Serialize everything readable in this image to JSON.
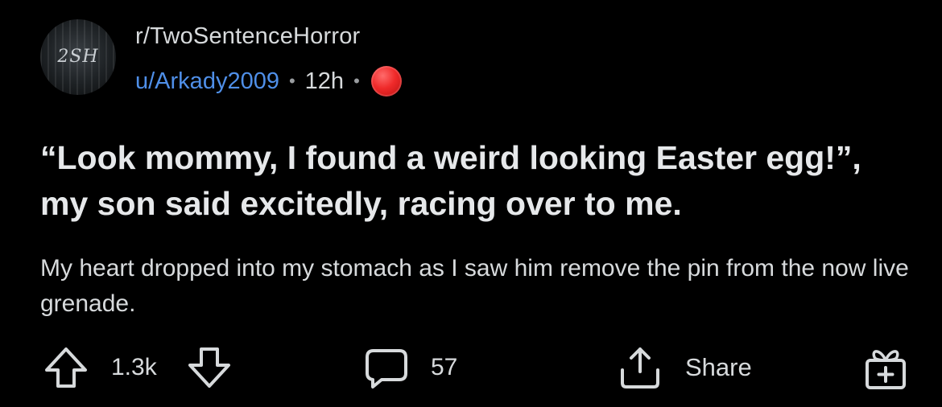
{
  "post": {
    "subreddit": "r/TwoSentenceHorror",
    "avatar_text": "2SH",
    "author": "u/Arkady2009",
    "separator": "•",
    "time": "12h",
    "award_icon": "red-circle-award-icon",
    "title": "“Look mommy, I found a weird looking Easter egg!”, my son said excitedly, racing over to me.",
    "body": "My heart dropped into my stomach as I saw him remove the pin from the now live grenade."
  },
  "actions": {
    "score": "1.3k",
    "comments": "57",
    "share_label": "Share"
  },
  "icons": {
    "upvote": "upvote-arrow-icon",
    "downvote": "downvote-arrow-icon",
    "comment": "comment-bubble-icon",
    "share": "share-icon",
    "award": "gift-award-icon"
  },
  "colors": {
    "background": "#000000",
    "text": "#d7dadc",
    "username": "#4f8fe8",
    "award_red": "#ef2a2a"
  }
}
